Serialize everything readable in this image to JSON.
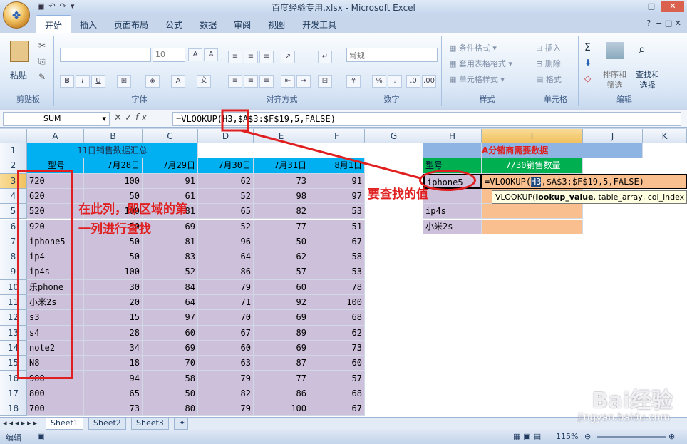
{
  "window": {
    "title": "百度经验专用.xlsx - Microsoft Excel",
    "controls": [
      "−",
      "□",
      "✕"
    ]
  },
  "ribbon_tabs": [
    "开始",
    "插入",
    "页面布局",
    "公式",
    "数据",
    "审阅",
    "视图",
    "开发工具"
  ],
  "ribbon_tab_active": "开始",
  "ribbon": {
    "clipboard": {
      "paste": "粘贴",
      "label": "剪贴板"
    },
    "font": {
      "size": "10",
      "label": "字体",
      "bold": "B",
      "italic": "I",
      "underline": "U"
    },
    "alignment": {
      "label": "对齐方式"
    },
    "number": {
      "format": "常规",
      "label": "数字",
      "percent": "%",
      "comma": ","
    },
    "styles": {
      "conditional": "条件格式",
      "table": "套用表格格式",
      "cell": "单元格样式",
      "label": "样式"
    },
    "cells": {
      "insert": "插入",
      "delete": "删除",
      "format": "格式",
      "label": "单元格"
    },
    "editing": {
      "sort_line1": "排序和",
      "sort_line2": "筛选",
      "find_line1": "查找和",
      "find_line2": "选择",
      "label": "编辑",
      "sigma": "Σ"
    }
  },
  "formula_bar": {
    "name_box": "SUM",
    "formula": "=VLOOKUP(H3,$A$3:$F$19,5,FALSE)"
  },
  "columns": [
    "A",
    "B",
    "C",
    "D",
    "E",
    "F",
    "G",
    "H",
    "I",
    "J",
    "K"
  ],
  "rows": [
    "1",
    "2",
    "3",
    "4",
    "5",
    "6",
    "7",
    "8",
    "9",
    "10",
    "11",
    "12",
    "13",
    "14",
    "15",
    "16",
    "17",
    "18"
  ],
  "table_title": "11日销售数据汇总",
  "table_headers": [
    "型号",
    "7月28日",
    "7月29日",
    "7月30日",
    "7月31日",
    "8月1日"
  ],
  "table_rows": [
    [
      "720",
      "100",
      "91",
      "62",
      "73",
      "91"
    ],
    [
      "620",
      "50",
      "61",
      "52",
      "98",
      "97"
    ],
    [
      "520",
      "100",
      "81",
      "65",
      "82",
      "53"
    ],
    [
      "920",
      "50",
      "69",
      "52",
      "77",
      "51"
    ],
    [
      "iphone5",
      "50",
      "81",
      "96",
      "50",
      "67"
    ],
    [
      "ip4",
      "50",
      "83",
      "64",
      "62",
      "58"
    ],
    [
      "ip4s",
      "100",
      "52",
      "86",
      "57",
      "53"
    ],
    [
      "乐phone",
      "30",
      "84",
      "79",
      "60",
      "78"
    ],
    [
      "小米2s",
      "20",
      "64",
      "71",
      "92",
      "100"
    ],
    [
      "s3",
      "15",
      "97",
      "70",
      "69",
      "68"
    ],
    [
      "s4",
      "28",
      "60",
      "67",
      "89",
      "62"
    ],
    [
      "note2",
      "34",
      "69",
      "60",
      "69",
      "73"
    ],
    [
      "N8",
      "18",
      "70",
      "63",
      "87",
      "60"
    ],
    [
      "900",
      "94",
      "58",
      "79",
      "77",
      "57"
    ],
    [
      "800",
      "65",
      "50",
      "82",
      "86",
      "68"
    ],
    [
      "700",
      "73",
      "80",
      "79",
      "100",
      "67"
    ]
  ],
  "right_table": {
    "title": "A分销商需要数据",
    "header_model": "型号",
    "header_qty": "7/30销售数量",
    "models": [
      "iphone5",
      "",
      "ip4s",
      "小米2s"
    ],
    "editing_formula_prefix": "=VLOOKUP(",
    "editing_formula_ref": "H3",
    "editing_formula_rest": ",$A$3:$F$19,5,FALSE)"
  },
  "tooltip": {
    "prefix": "VLOOKUP(",
    "bold_arg": "lookup_value",
    "rest": ", table_array, col_index"
  },
  "annotations": {
    "left_line1": "在此列，即区域的第",
    "left_line2": "一列进行查找",
    "lookup_value": "要查找的值"
  },
  "sheets": [
    "Sheet1",
    "Sheet2",
    "Sheet3"
  ],
  "status": {
    "mode": "编辑",
    "zoom": "115%"
  },
  "watermark": {
    "brand": "Bai经验",
    "url": "jingyan.baidu.com"
  },
  "colors": {
    "accent_red": "#e02020",
    "table_purple": "#ccc0da",
    "title_cyan": "#00b0f0",
    "header_green": "#00b050",
    "qty_peach": "#fabf8f"
  }
}
